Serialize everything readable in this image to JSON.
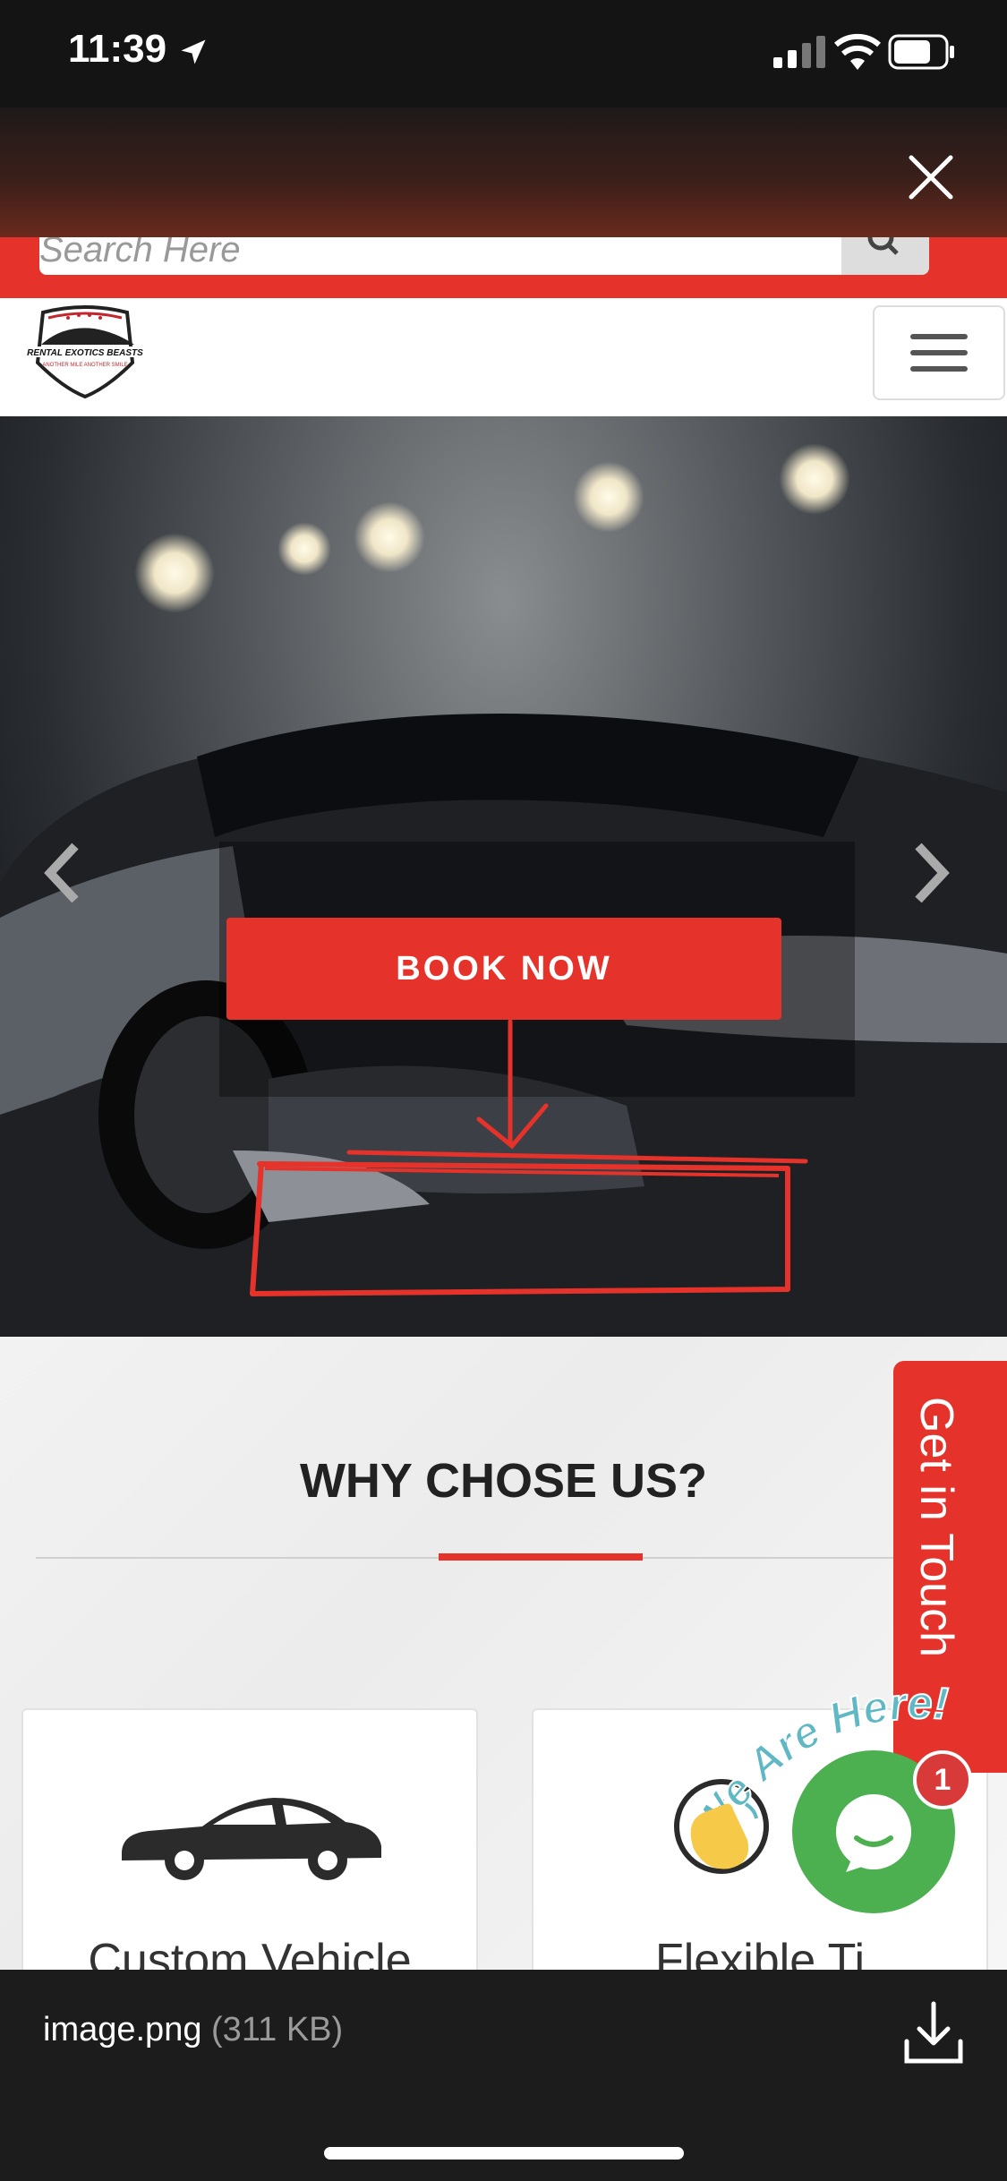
{
  "status_bar": {
    "time": "11:39",
    "icons": [
      "location-arrow-icon",
      "cellular-signal-icon",
      "wifi-icon",
      "battery-icon"
    ]
  },
  "quicklook": {
    "close_icon": "close-icon"
  },
  "website": {
    "search": {
      "placeholder": "Search Here"
    },
    "logo_text": "RENTAL EXOTICS BEASTS",
    "logo_tagline": "ANOTHER MILE ANOTHER SMILE",
    "hero": {
      "book_now": "BOOK NOW"
    },
    "why": {
      "title": "WHY CHOSE US?",
      "card1": "Custom Vehicle",
      "card2": "Flexible Ti"
    },
    "get_in_touch": "Get in Touch",
    "chat": {
      "label": "We Are Here!",
      "badge": "1"
    }
  },
  "footer": {
    "file_name": "image.png",
    "file_size": "(311 KB)"
  },
  "colors": {
    "accent": "#e5322a",
    "chat": "#4caf50"
  }
}
